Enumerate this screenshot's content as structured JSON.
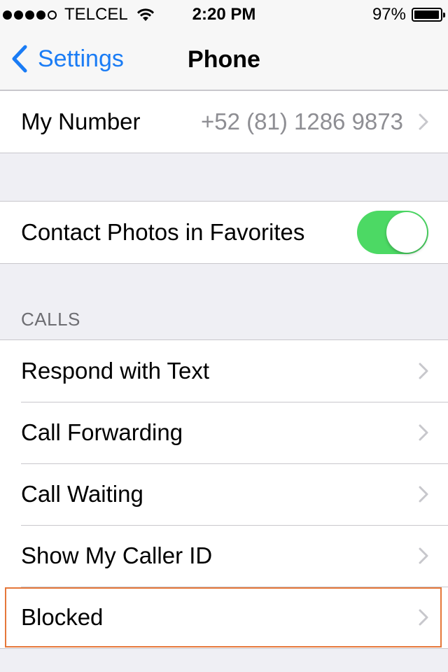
{
  "status_bar": {
    "signal_filled_dots": 4,
    "signal_total_dots": 5,
    "carrier": "TELCEL",
    "time": "2:20 PM",
    "battery_percent": "97%",
    "battery_level": 0.97
  },
  "nav": {
    "back_label": "Settings",
    "title": "Phone"
  },
  "my_number": {
    "label": "My Number",
    "value": "+52 (81) 1286 9873"
  },
  "contact_photos": {
    "label": "Contact Photos in Favorites",
    "enabled": true
  },
  "calls_section": {
    "header": "CALLS",
    "items": [
      {
        "label": "Respond with Text"
      },
      {
        "label": "Call Forwarding"
      },
      {
        "label": "Call Waiting"
      },
      {
        "label": "Show My Caller ID"
      },
      {
        "label": "Blocked"
      }
    ]
  },
  "colors": {
    "accent": "#1a7cf5",
    "toggle_on": "#4cd964",
    "highlight": "#e5773a",
    "background": "#efeff4"
  },
  "icons": {
    "back": "chevron-left-icon",
    "disclosure": "chevron-right-icon",
    "wifi": "wifi-icon",
    "battery": "battery-icon"
  }
}
